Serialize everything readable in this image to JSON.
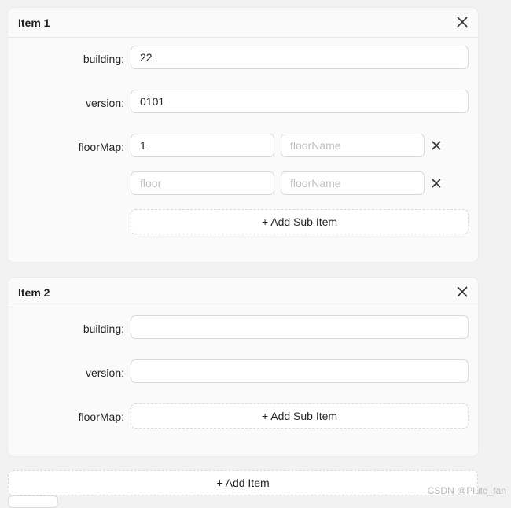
{
  "items": [
    {
      "title": "Item 1",
      "building_label": "building:",
      "building_value": "22",
      "version_label": "version:",
      "version_value": "0101",
      "floormap_label": "floorMap:",
      "floor_rows": [
        {
          "floor_value": "1",
          "floor_placeholder": "floor",
          "floorname_value": "",
          "floorname_placeholder": "floorName"
        },
        {
          "floor_value": "",
          "floor_placeholder": "floor",
          "floorname_value": "",
          "floorname_placeholder": "floorName"
        }
      ],
      "add_sub_item_label": "+ Add Sub Item"
    },
    {
      "title": "Item 2",
      "building_label": "building:",
      "building_value": "",
      "version_label": "version:",
      "version_value": "",
      "floormap_label": "floorMap:",
      "floor_rows": [],
      "add_sub_item_label": "+ Add Sub Item"
    }
  ],
  "add_item_label": "+ Add Item",
  "watermark": "CSDN @Pluto_fan"
}
